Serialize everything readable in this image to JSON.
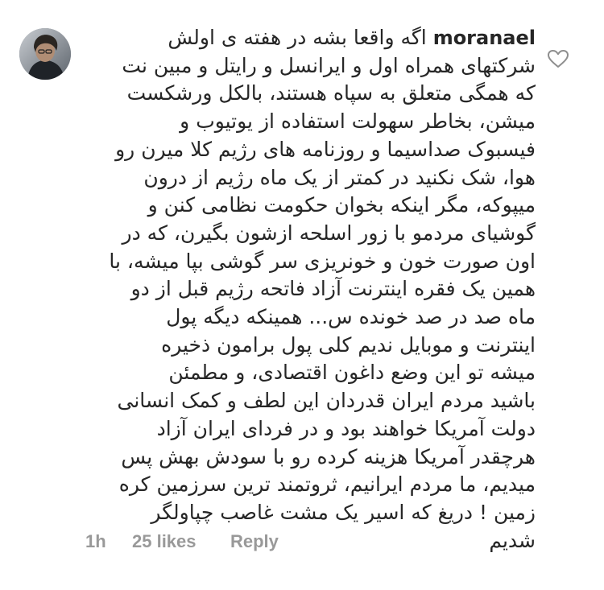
{
  "comment": {
    "username": "moranael",
    "first_line_text": "اگه واقعا بشه در هفته ی اولش",
    "lines": [
      "شرکتهای همراه اول و ایرانسل و رایتل و مبین نت",
      "که همگی متعلق به سپاه هستند، بالکل ورشکست",
      "میشن، بخاطر سهولت استفاده از یوتیوب و",
      "فیسبوک صداسیما و روزنامه های رژیم کلا میرن رو",
      "هوا، شک نکنید در کمتر از یک ماه رژیم از درون",
      "میپوکه، مگر اینکه بخوان حکومت نظامی کنن و",
      "گوشیای مردمو با زور اسلحه ازشون بگیرن، که در",
      "اون صورت خون و خونریزی سر گوشی بپا میشه، با",
      "همین یک فقره اینترنت آزاد فاتحه رژیم قبل از دو",
      "ماه صد در صد خونده س... همینکه دیگه پول",
      "اینترنت و موبایل ندیم کلی پول برامون ذخیره",
      "میشه تو این وضع داغون اقتصادی، و مطمئن",
      "باشید مردم ایران قدردان این لطف و کمک انسانی",
      "دولت آمریکا خواهند بود و در فردای ایران آزاد",
      "هرچقدر آمریکا هزینه کرده رو با سودش بهش پس",
      "میدیم،  ما مردم ایرانیم، ثروتمند ترین سرزمین کره",
      "زمین ! دریغ که اسیر یک مشت غاصب چپاولگر",
      "شدیم"
    ],
    "avatar_icon": "user-avatar-photo",
    "like_icon": "heart-outline-icon"
  },
  "meta": {
    "time": "1h",
    "likes": "25 likes",
    "reply": "Reply"
  },
  "colors": {
    "text": "#262626",
    "meta": "#999999",
    "icon": "#8e8e8e",
    "background": "#ffffff"
  }
}
